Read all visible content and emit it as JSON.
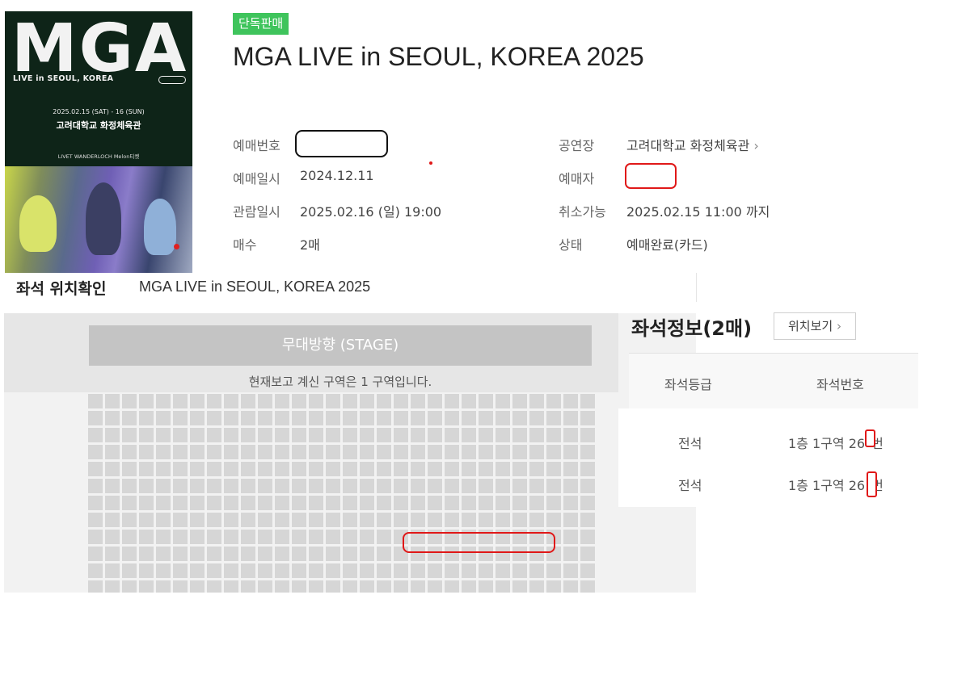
{
  "poster": {
    "logo": "MGA",
    "subtitle": "LIVE in SEOUL, KOREA",
    "date": "2025.02.15 (SAT) - 16 (SUN)",
    "venue": "고려대학교 화정체육관",
    "sponsors": "LIVET   WANDERLOCH   Melon티켓"
  },
  "header": {
    "badge": "단독판매",
    "title": "MGA LIVE in SEOUL, KOREA 2025"
  },
  "info_left": [
    {
      "label": "예매번호",
      "value": ""
    },
    {
      "label": "예매일시",
      "value": "2024.12.11"
    },
    {
      "label": "관람일시",
      "value": "2025.02.16 (일) 19:00"
    },
    {
      "label": "매수",
      "value": "2매"
    }
  ],
  "info_right": [
    {
      "label": "공연장",
      "value": "고려대학교 화정체육관"
    },
    {
      "label": "예매자",
      "value": ""
    },
    {
      "label": "취소가능",
      "value": "2025.02.15 11:00 까지"
    },
    {
      "label": "상태",
      "value": "예매완료(카드)"
    }
  ],
  "venue_link_icon": "chevron-right-icon",
  "seat_section": {
    "label": "좌석 위치확인",
    "title": "MGA LIVE in SEOUL, KOREA 2025"
  },
  "seat_map": {
    "stage_label": "무대방향 (STAGE)",
    "zone_text": "현재보고 계신 구역은 1 구역입니다."
  },
  "seat_info": {
    "title": "좌석정보(2매)",
    "location_button": "위치보기",
    "headers": [
      "좌석등급",
      "좌석번호"
    ],
    "rows": [
      {
        "grade": "전석",
        "seat_prefix": "1층 1구역 26",
        "seat_suffix": "번"
      },
      {
        "grade": "전석",
        "seat_prefix": "1층 1구역 26",
        "seat_suffix": "번"
      }
    ]
  },
  "colors": {
    "badge": "#3fc45c",
    "redaction": "#e01818",
    "stage": "#c4c4c4",
    "seat": "#d6d6d6"
  }
}
